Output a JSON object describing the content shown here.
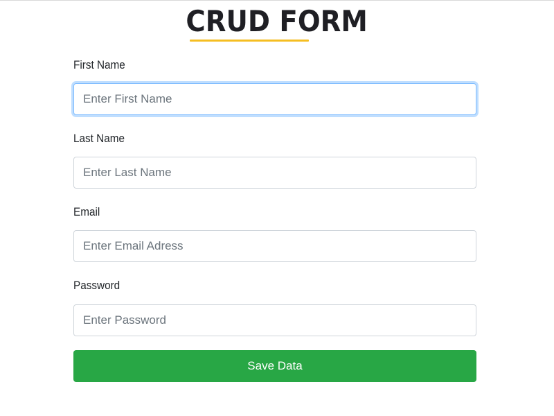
{
  "header": {
    "title": "CRUD FORM",
    "underline_color": "#f5be22"
  },
  "form": {
    "fields": [
      {
        "label": "First Name",
        "placeholder": "Enter First Name",
        "value": "",
        "focused": true
      },
      {
        "label": "Last Name",
        "placeholder": "Enter Last Name",
        "value": "",
        "focused": false
      },
      {
        "label": "Email",
        "placeholder": "Enter Email Adress",
        "value": "",
        "focused": false
      },
      {
        "label": "Password",
        "placeholder": "Enter Password",
        "value": "",
        "focused": false
      }
    ],
    "submit_label": "Save Data",
    "submit_color": "#28a745"
  }
}
